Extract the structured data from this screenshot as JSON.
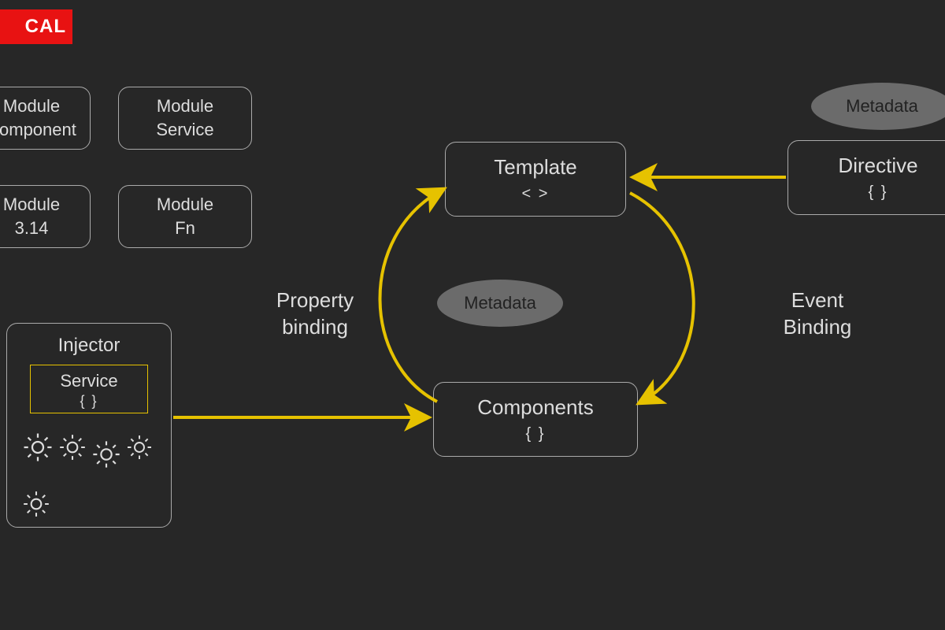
{
  "logo": {
    "text": "CAL"
  },
  "modules": {
    "module_component": {
      "line1": "Module",
      "line2": "Component"
    },
    "module_service": {
      "line1": "Module",
      "line2": "Service"
    },
    "module_value": {
      "line1": "Module",
      "line2": "3.14"
    },
    "module_fn": {
      "line1": "Module",
      "line2": "Fn"
    }
  },
  "injector": {
    "title": "Injector",
    "service_label": "Service",
    "service_sub": "{ }"
  },
  "nodes": {
    "template": {
      "label": "Template",
      "sub": "<  >"
    },
    "components": {
      "label": "Components",
      "sub": "{ }"
    },
    "directive": {
      "label": "Directive",
      "sub": "{ }"
    }
  },
  "ellipses": {
    "metadata_center": "Metadata",
    "metadata_top": "Metadata"
  },
  "labels": {
    "property_binding_line1": "Property",
    "property_binding_line2": "binding",
    "event_binding_line1": "Event",
    "event_binding_line2": "Binding"
  },
  "colors": {
    "bg": "#272727",
    "border": "#aaaaaa",
    "accent": "#e6c200",
    "logo_bg": "#e81212",
    "ellipse": "#6b6b6b"
  }
}
